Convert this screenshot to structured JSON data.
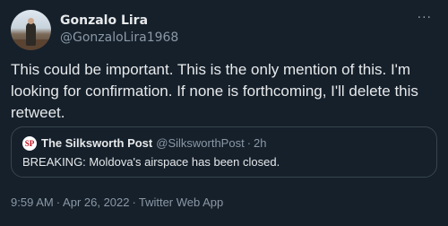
{
  "author": {
    "display_name": "Gonzalo Lira",
    "handle": "@GonzaloLira1968"
  },
  "more_icon": "···",
  "tweet": {
    "text": "This could be important. This is the only mention of this. I'm looking for confirmation. If none is forthcoming, I'll delete this retweet."
  },
  "quoted": {
    "avatar_text": "SP",
    "display_name": "The Silksworth Post",
    "handle": "@SilksworthPost",
    "separator": "·",
    "time": "2h",
    "text": "BREAKING: Moldova's airspace has been closed."
  },
  "meta": {
    "time": "9:59 AM",
    "separator": "·",
    "date": "Apr 26, 2022",
    "client": "Twitter Web App"
  },
  "colors": {
    "background": "#15202b",
    "primary_text": "#e7e9ea",
    "secondary_text": "#8b98a5",
    "border": "#38444d"
  }
}
